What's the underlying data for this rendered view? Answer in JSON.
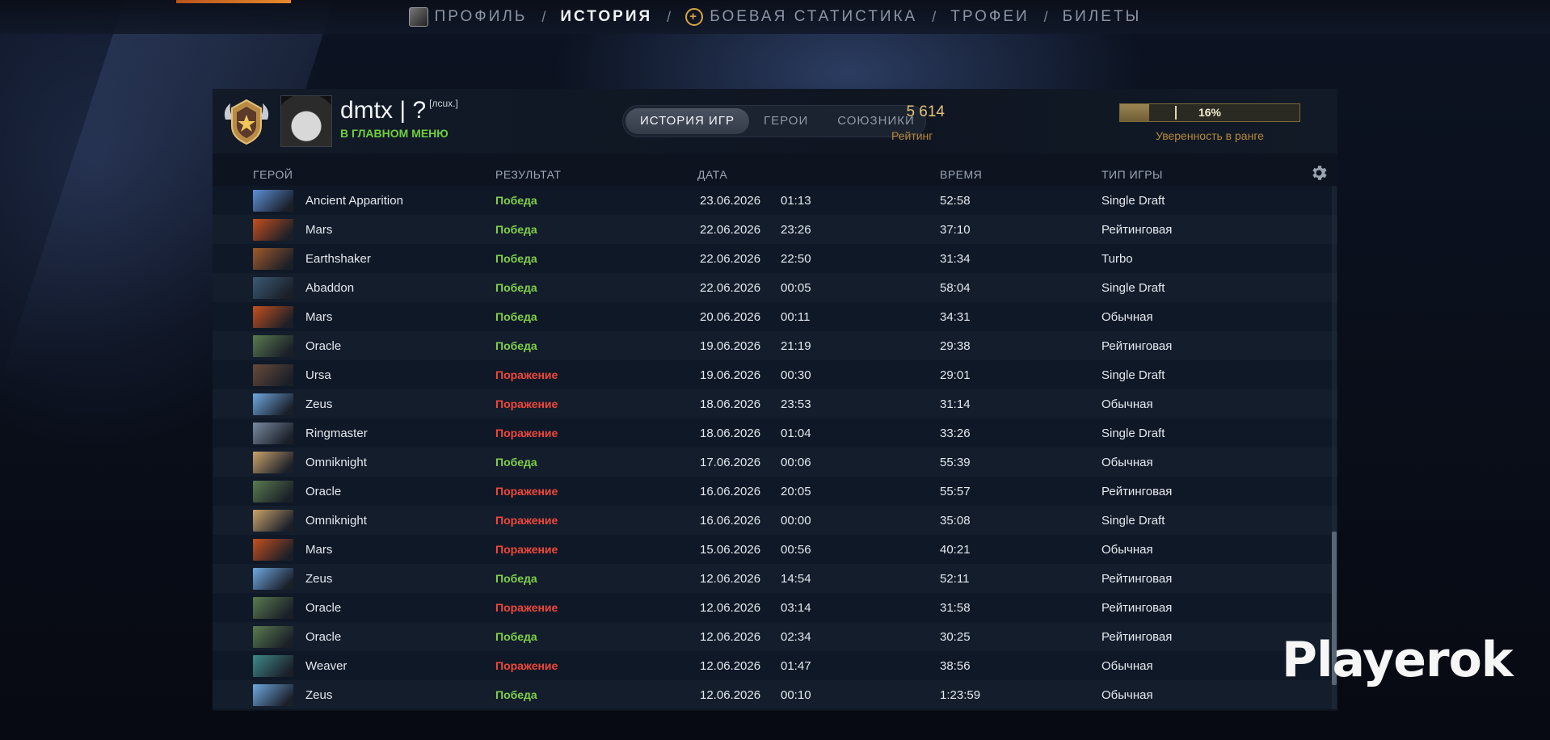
{
  "topnav": {
    "items": [
      "ПРОФИЛЬ",
      "ИСТОРИЯ",
      "БОЕВАЯ СТАТИСТИКА",
      "ТРОФЕИ",
      "БИЛЕТЫ"
    ],
    "separator": "/",
    "active": "ИСТОРИЯ"
  },
  "player": {
    "name": "dmtx | ?",
    "tag": "[лсux.]",
    "status": "В ГЛАВНОМ МЕНЮ"
  },
  "tabs": [
    "ИСТОРИЯ ИГР",
    "ГЕРОИ",
    "СОЮЗНИКИ"
  ],
  "rating": {
    "value": "5 614",
    "label": "Рейтинг",
    "confidence_percent": 16,
    "confidence_text": "16%",
    "confidence_label": "Уверенность в ранге"
  },
  "table": {
    "headers": [
      "ГЕРОЙ",
      "РЕЗУЛЬТАТ",
      "ДАТА",
      "ВРЕМЯ",
      "ТИП ИГРЫ"
    ],
    "rows": [
      {
        "hero": "Ancient Apparition",
        "result": "Победа",
        "win": true,
        "date": "23.06.2026",
        "time": "01:13",
        "duration": "52:58",
        "type": "Single Draft",
        "color": "#5d8fd6"
      },
      {
        "hero": "Mars",
        "result": "Победа",
        "win": true,
        "date": "22.06.2026",
        "time": "23:26",
        "duration": "37:10",
        "type": "Рейтинговая",
        "color": "#c4501e"
      },
      {
        "hero": "Earthshaker",
        "result": "Победа",
        "win": true,
        "date": "22.06.2026",
        "time": "22:50",
        "duration": "31:34",
        "type": "Turbo",
        "color": "#a05a2a"
      },
      {
        "hero": "Abaddon",
        "result": "Победа",
        "win": true,
        "date": "22.06.2026",
        "time": "00:05",
        "duration": "58:04",
        "type": "Single Draft",
        "color": "#3b5a73"
      },
      {
        "hero": "Mars",
        "result": "Победа",
        "win": true,
        "date": "20.06.2026",
        "time": "00:11",
        "duration": "34:31",
        "type": "Обычная",
        "color": "#c4501e"
      },
      {
        "hero": "Oracle",
        "result": "Победа",
        "win": true,
        "date": "19.06.2026",
        "time": "21:19",
        "duration": "29:38",
        "type": "Рейтинговая",
        "color": "#5b7a4f"
      },
      {
        "hero": "Ursa",
        "result": "Поражение",
        "win": false,
        "date": "19.06.2026",
        "time": "00:30",
        "duration": "29:01",
        "type": "Single Draft",
        "color": "#6a4a3a"
      },
      {
        "hero": "Zeus",
        "result": "Поражение",
        "win": false,
        "date": "18.06.2026",
        "time": "23:53",
        "duration": "31:14",
        "type": "Обычная",
        "color": "#6fa8e0"
      },
      {
        "hero": "Ringmaster",
        "result": "Поражение",
        "win": false,
        "date": "18.06.2026",
        "time": "01:04",
        "duration": "33:26",
        "type": "Single Draft",
        "color": "#7a8aa0"
      },
      {
        "hero": "Omniknight",
        "result": "Победа",
        "win": true,
        "date": "17.06.2026",
        "time": "00:06",
        "duration": "55:39",
        "type": "Обычная",
        "color": "#c9a36a"
      },
      {
        "hero": "Oracle",
        "result": "Поражение",
        "win": false,
        "date": "16.06.2026",
        "time": "20:05",
        "duration": "55:57",
        "type": "Рейтинговая",
        "color": "#5b7a4f"
      },
      {
        "hero": "Omniknight",
        "result": "Поражение",
        "win": false,
        "date": "16.06.2026",
        "time": "00:00",
        "duration": "35:08",
        "type": "Single Draft",
        "color": "#c9a36a"
      },
      {
        "hero": "Mars",
        "result": "Поражение",
        "win": false,
        "date": "15.06.2026",
        "time": "00:56",
        "duration": "40:21",
        "type": "Обычная",
        "color": "#c4501e"
      },
      {
        "hero": "Zeus",
        "result": "Победа",
        "win": true,
        "date": "12.06.2026",
        "time": "14:54",
        "duration": "52:11",
        "type": "Рейтинговая",
        "color": "#6fa8e0"
      },
      {
        "hero": "Oracle",
        "result": "Поражение",
        "win": false,
        "date": "12.06.2026",
        "time": "03:14",
        "duration": "31:58",
        "type": "Рейтинговая",
        "color": "#5b7a4f"
      },
      {
        "hero": "Oracle",
        "result": "Победа",
        "win": true,
        "date": "12.06.2026",
        "time": "02:34",
        "duration": "30:25",
        "type": "Рейтинговая",
        "color": "#5b7a4f"
      },
      {
        "hero": "Weaver",
        "result": "Поражение",
        "win": false,
        "date": "12.06.2026",
        "time": "01:47",
        "duration": "38:56",
        "type": "Обычная",
        "color": "#3f8a8a"
      },
      {
        "hero": "Zeus",
        "result": "Победа",
        "win": true,
        "date": "12.06.2026",
        "time": "00:10",
        "duration": "1:23:59",
        "type": "Обычная",
        "color": "#6fa8e0"
      }
    ]
  },
  "watermark": "Playerok",
  "icons": {
    "settings": "gear-icon",
    "profile": "profile-icon",
    "stats": "plus-badge-icon",
    "rank": "rank-medal-icon"
  }
}
